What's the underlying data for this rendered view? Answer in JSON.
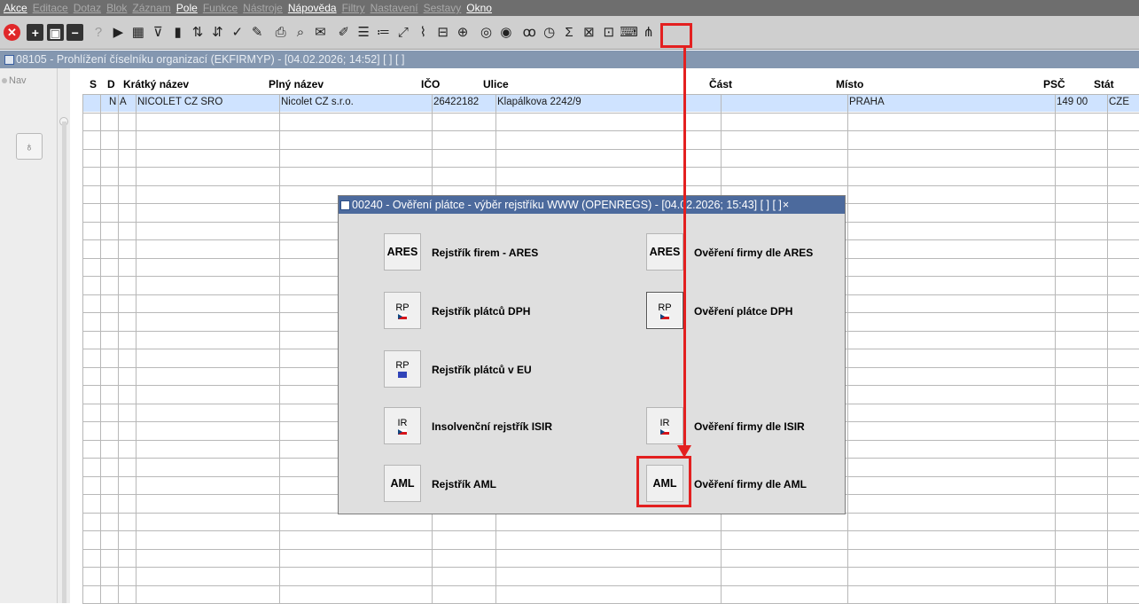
{
  "menubar": {
    "items": [
      {
        "label": "Akce",
        "enabled": true
      },
      {
        "label": "Editace",
        "enabled": false
      },
      {
        "label": "Dotaz",
        "enabled": false
      },
      {
        "label": "Blok",
        "enabled": false
      },
      {
        "label": "Záznam",
        "enabled": false
      },
      {
        "label": "Pole",
        "enabled": true
      },
      {
        "label": "Funkce",
        "enabled": false
      },
      {
        "label": "Nástroje",
        "enabled": false
      },
      {
        "label": "Nápověda",
        "enabled": true
      },
      {
        "label": "Filtry",
        "enabled": false
      },
      {
        "label": "Nastavení",
        "enabled": false
      },
      {
        "label": "Sestavy",
        "enabled": false
      },
      {
        "label": "Okno",
        "enabled": true
      }
    ]
  },
  "toolbar": {
    "icons": [
      {
        "name": "close-icon",
        "glyph": "✕"
      },
      {
        "name": "add-record-icon",
        "glyph": "+"
      },
      {
        "name": "save-icon",
        "glyph": "▣"
      },
      {
        "name": "delete-record-icon",
        "glyph": "−"
      },
      {
        "name": "help-icon",
        "glyph": "?"
      },
      {
        "name": "run-icon",
        "glyph": "▶"
      },
      {
        "name": "calendar-icon",
        "glyph": "▦"
      },
      {
        "name": "filter-icon",
        "glyph": "⊽"
      },
      {
        "name": "chart-icon",
        "glyph": "▮"
      },
      {
        "name": "sort-asc-icon",
        "glyph": "⇅"
      },
      {
        "name": "sort-desc-icon",
        "glyph": "⇵"
      },
      {
        "name": "check-icon",
        "glyph": "✓"
      },
      {
        "name": "wrench-icon",
        "glyph": "✎"
      },
      {
        "name": "print-icon",
        "glyph": "⎙"
      },
      {
        "name": "print-preview-icon",
        "glyph": "⌕"
      },
      {
        "name": "mail-icon",
        "glyph": "✉"
      },
      {
        "name": "edit-icon",
        "glyph": "✐"
      },
      {
        "name": "list-icon",
        "glyph": "☰"
      },
      {
        "name": "numbered-list-icon",
        "glyph": "≔"
      },
      {
        "name": "fullscreen-icon",
        "glyph": "⤢"
      },
      {
        "name": "attachment-icon",
        "glyph": "⌇"
      },
      {
        "name": "form-icon",
        "glyph": "⊟"
      },
      {
        "name": "globe-icon",
        "glyph": "⊕"
      },
      {
        "name": "compass-icon",
        "glyph": "◎"
      },
      {
        "name": "eye-icon",
        "glyph": "◉"
      },
      {
        "name": "glasses-icon",
        "glyph": "ꝏ"
      },
      {
        "name": "clock-icon",
        "glyph": "◷"
      },
      {
        "name": "sum-icon",
        "glyph": "Σ"
      },
      {
        "name": "excel-icon",
        "glyph": "⊠"
      },
      {
        "name": "export-icon",
        "glyph": "⊡"
      },
      {
        "name": "keyboard-icon",
        "glyph": "⌨"
      },
      {
        "name": "tree-icon",
        "glyph": "⋔"
      }
    ]
  },
  "window": {
    "title": "08105 - Prohlížení číselníku organizací (EKFIRMYP) - [04.02.2026; 14:52]  [ ]  [ ]",
    "nav_label": "Nav"
  },
  "grid": {
    "columns": [
      "S",
      "D",
      "Krátký název",
      "Plný název",
      "IČO",
      "Ulice",
      "Část",
      "Místo",
      "PSČ",
      "Stát"
    ],
    "row": [
      "",
      "N",
      "A",
      "NICOLET CZ SRO",
      "Nicolet CZ s.r.o.",
      "26422182",
      "Klapálkova 2242/9",
      "",
      "PRAHA",
      "149 00",
      "CZE"
    ]
  },
  "dialog": {
    "title": "00240 - Ověření plátce - výběr rejstříku WWW (OPENREGS) - [04.02.2026; 15:43]  [ ]  [ ]",
    "close": "×",
    "left": [
      {
        "btn": "ARES",
        "label": "Rejstřík firem - ARES"
      },
      {
        "btn": "RP",
        "label": "Rejstřík plátců DPH"
      },
      {
        "btn": "RP",
        "label": "Rejstřík plátců v EU"
      },
      {
        "btn": "IR",
        "label": "Insolvenční rejstřík ISIR"
      },
      {
        "btn": "AML",
        "label": "Rejstřík AML"
      }
    ],
    "right": [
      {
        "btn": "ARES",
        "label": "Ověření firmy dle ARES"
      },
      {
        "btn": "RP",
        "label": "Ověření plátce DPH"
      },
      {
        "btn": "IR",
        "label": "Ověření firmy dle ISIR"
      },
      {
        "btn": "AML",
        "label": "Ověření firmy dle AML"
      }
    ]
  },
  "colors": {
    "accent_red": "#e32020",
    "title_bar": "#8497b0",
    "dialog_title": "#4c6a9d",
    "selected_row": "#cfe3ff"
  }
}
